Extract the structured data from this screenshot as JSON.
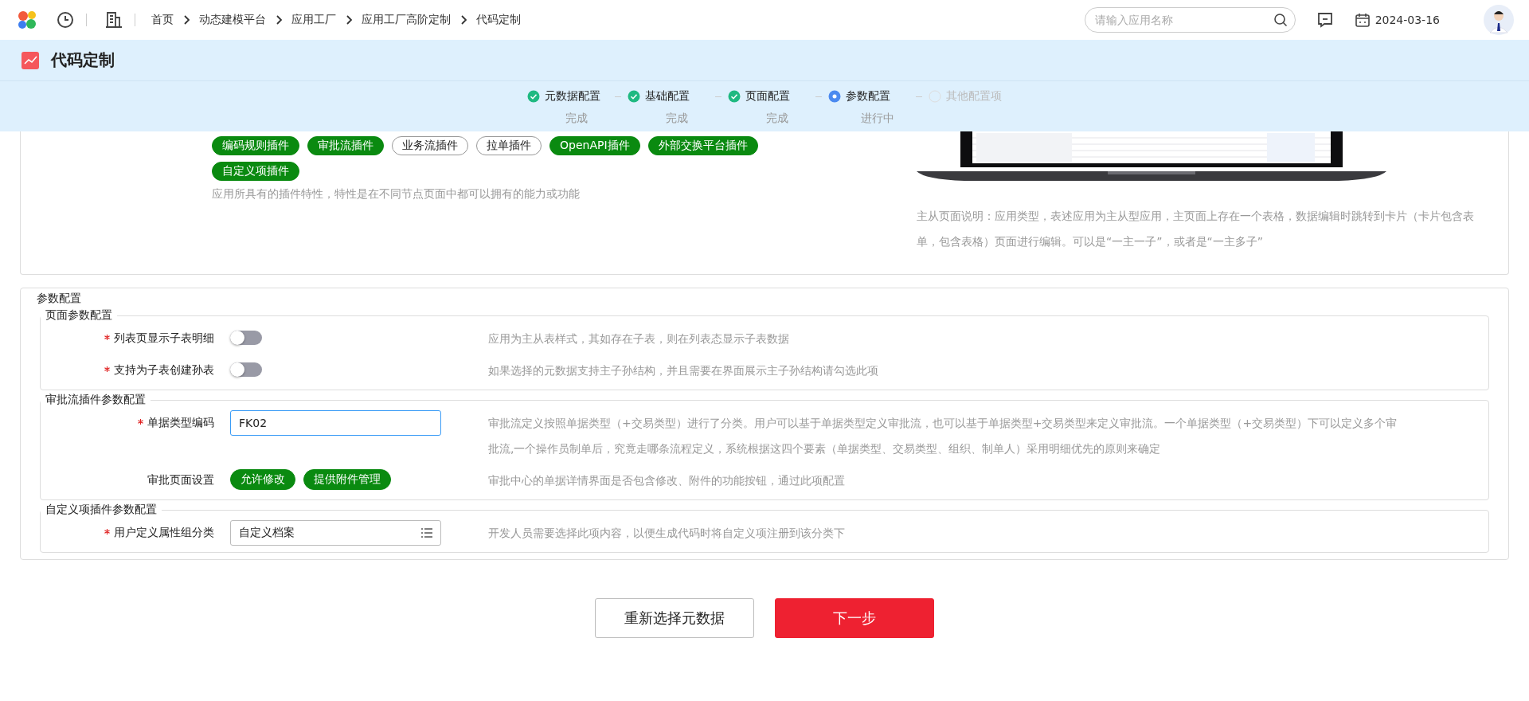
{
  "top_bar": {
    "breadcrumb": [
      "首页",
      "动态建模平台",
      "应用工厂",
      "应用工厂高阶定制",
      "代码定制"
    ],
    "search": {
      "placeholder": "请输入应用名称"
    },
    "date": "2024-03-16"
  },
  "page_title": "代码定制",
  "steps": [
    {
      "label": "元数据配置",
      "kind": "done",
      "caption": "完成"
    },
    {
      "label": "基础配置",
      "kind": "done",
      "caption": "完成"
    },
    {
      "label": "页面配置",
      "kind": "done",
      "caption": "完成"
    },
    {
      "label": "参数配置",
      "kind": "active",
      "caption": "进行中"
    },
    {
      "label": "其他配置项",
      "kind": "pending"
    }
  ],
  "plugins": {
    "chips": [
      {
        "label": "编码规则插件",
        "selected": true
      },
      {
        "label": "审批流插件",
        "selected": true
      },
      {
        "label": "业务流插件",
        "selected": false
      },
      {
        "label": "拉单插件",
        "selected": false
      },
      {
        "label": "OpenAPI插件",
        "selected": true
      },
      {
        "label": "外部交换平台插件",
        "selected": true
      },
      {
        "label": "自定义项插件",
        "selected": true
      }
    ],
    "hint": "应用所具有的插件特性，特性是在不同节点页面中都可以拥有的能力或功能"
  },
  "preview": {
    "caption": "主从页面说明：应用类型，表述应用为主从型应用，主页面上存在一个表格，数据编辑时跳转到卡片（卡片包含表单，包含表格）页面进行编辑。可以是“一主一子”，或者是“一主多子”"
  },
  "param_config": {
    "legend": "参数配置",
    "groups": [
      {
        "legend": "页面参数配置",
        "rows": [
          {
            "kind": "switch",
            "label": "列表页显示子表明细",
            "required": true,
            "on": false,
            "help": "应用为主从表样式，其如存在子表，则在列表态显示子表数据"
          },
          {
            "kind": "switch",
            "label": "支持为子表创建孙表",
            "required": true,
            "on": false,
            "help": "如果选择的元数据支持主子孙结构，并且需要在界面展示主子孙结构请勾选此项"
          }
        ]
      },
      {
        "legend": "审批流插件参数配置",
        "rows": [
          {
            "kind": "text",
            "label": "单据类型编码",
            "required": true,
            "value": "FK02",
            "help": "审批流定义按照单据类型（+交易类型）进行了分类。用户可以基于单据类型定义审批流，也可以基于单据类型+交易类型来定义审批流。一个单据类型（+交易类型）下可以定义多个审批流,一个操作员制单后，究竟走哪条流程定义，系统根据这四个要素（单据类型、交易类型、组织、制单人）采用明细优先的原则来确定"
          },
          {
            "kind": "chips",
            "label": "审批页面设置",
            "required": false,
            "options": [
              {
                "label": "允许修改",
                "selected": true
              },
              {
                "label": "提供附件管理",
                "selected": true
              }
            ],
            "help": "审批中心的单据详情界面是否包含修改、附件的功能按钮，通过此项配置"
          }
        ]
      },
      {
        "legend": "自定义项插件参数配置",
        "rows": [
          {
            "kind": "select",
            "label": "用户定义属性组分类",
            "required": true,
            "value": "自定义档案",
            "help": "开发人员需要选择此项内容，以便生成代码时将自定义项注册到该分类下"
          }
        ]
      }
    ]
  },
  "actions": [
    {
      "label": "重新选择元数据",
      "kind": "secondary"
    },
    {
      "label": "下一步",
      "kind": "primary"
    }
  ]
}
